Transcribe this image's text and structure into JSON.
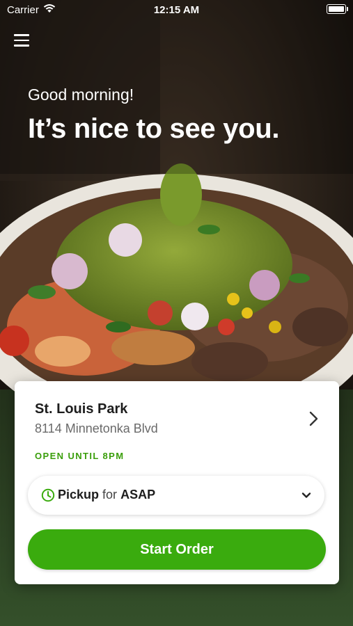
{
  "status_bar": {
    "carrier": "Carrier",
    "time": "12:15 AM"
  },
  "hero": {
    "greeting": "Good morning!",
    "headline": "It’s nice to see you."
  },
  "location": {
    "name": "St. Louis Park",
    "address": "8114 Minnetonka Blvd",
    "open_status": "OPEN UNTIL 8PM"
  },
  "pickup": {
    "mode": "Pickup",
    "connector": "for",
    "time": "ASAP"
  },
  "actions": {
    "start_order": "Start Order"
  },
  "colors": {
    "accent_green": "#3aab0e",
    "status_green": "#3a9e0b"
  },
  "icons": [
    "menu-icon",
    "wifi-icon",
    "battery-icon",
    "chevron-right-icon",
    "clock-icon",
    "chevron-down-icon"
  ]
}
